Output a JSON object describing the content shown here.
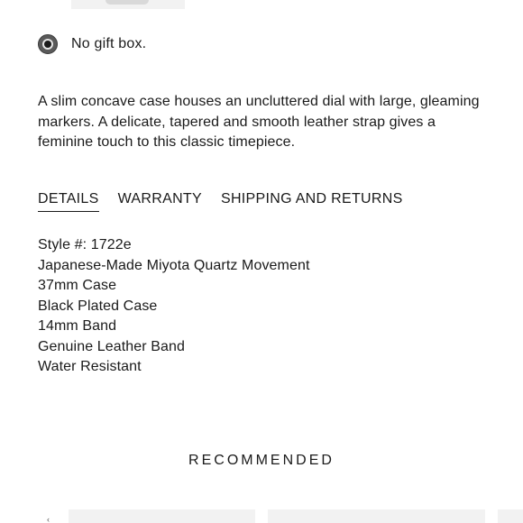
{
  "gift_option": {
    "label": "No gift box.",
    "selected": true
  },
  "description": "A slim concave case houses an uncluttered dial with large, gleaming markers. A delicate, tapered and smooth leather strap gives a feminine touch to this classic timepiece.",
  "tabs": [
    {
      "label": "DETAILS",
      "active": true
    },
    {
      "label": "WARRANTY",
      "active": false
    },
    {
      "label": "SHIPPING AND RETURNS",
      "active": false
    }
  ],
  "details": [
    "Style #: 1722e",
    "Japanese-Made Miyota Quartz Movement",
    "37mm Case",
    "Black Plated Case",
    "14mm Band",
    "Genuine Leather Band",
    "Water Resistant"
  ],
  "recommended": {
    "heading": "RECOMMENDED"
  },
  "colors": {
    "text": "#1a1a1a",
    "card_bg": "#f2f2f2",
    "radio_fill": "#5a5a5a"
  }
}
